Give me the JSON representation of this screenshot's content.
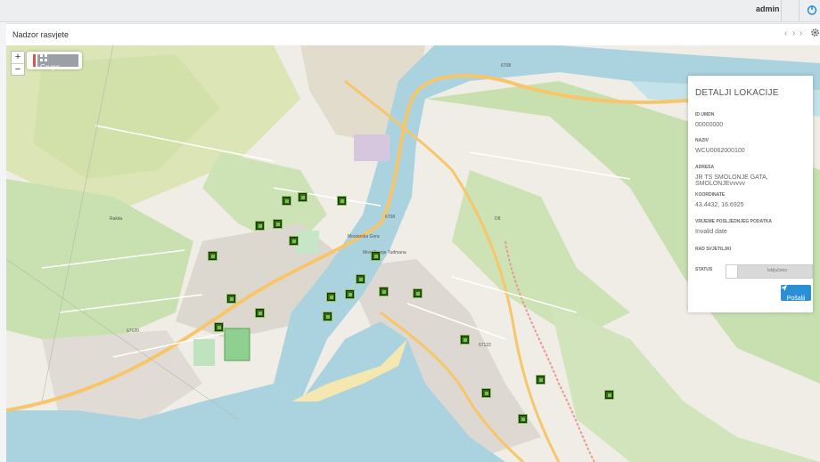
{
  "header": {
    "user": "admin",
    "power_icon": "power-icon"
  },
  "panel": {
    "title": "Nadzor rasvjete",
    "prev_icon": "chevron-left-icon",
    "next_icon": "chevron-right-icon",
    "gear_icon": "gear-icon"
  },
  "map": {
    "zoom_in": "+",
    "zoom_out": "−",
    "groups_button": "Grupe",
    "place_labels": [
      {
        "text": "Mostarska Gora"
      },
      {
        "text": "Rakita"
      },
      {
        "text": "Most Franje Tuđmana"
      },
      {
        "text": "6708"
      },
      {
        "text": "6708"
      },
      {
        "text": "D8"
      },
      {
        "text": "67120"
      },
      {
        "text": "67122"
      }
    ],
    "lamps_count_hidden": true
  },
  "detail": {
    "title": "DETALJI LOKACIJE",
    "fields": [
      {
        "label": "ID UMDN",
        "value": "00000000"
      },
      {
        "label": "NAZIV",
        "value": "WCU0062000100"
      },
      {
        "label": "ADRESA",
        "value": "JR TS SMOLONJE GATA, SMOLONJEvvvvv"
      },
      {
        "label": "KOORDINATE",
        "value": "43.4432, 16.6925"
      },
      {
        "label": "VRIJEME POSLJEDNJEG PODATKA",
        "value": "Invalid date"
      },
      {
        "label": "RAD SVJETILJKI",
        "value": ""
      }
    ],
    "status_label": "STATUS",
    "status_value": "Isključeno",
    "send_button": "Pošalji"
  }
}
